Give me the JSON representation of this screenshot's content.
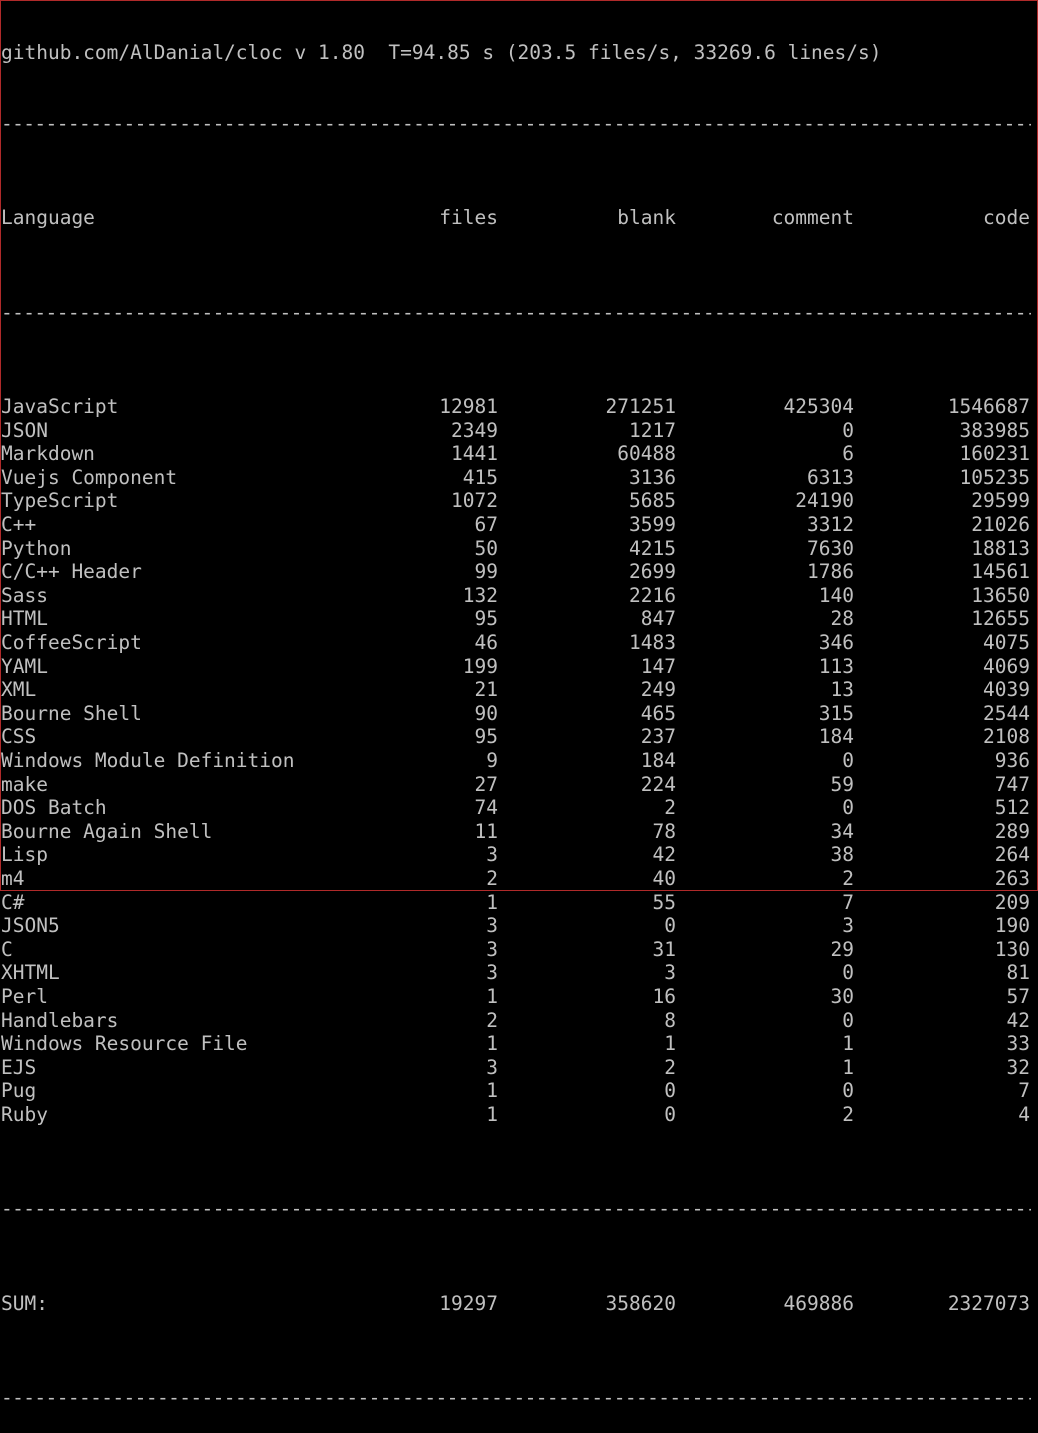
{
  "header": {
    "summary_line": "github.com/AlDanial/cloc v 1.80  T=94.85 s (203.5 files/s, 33269.6 lines/s)"
  },
  "separator": "-----------------------------------------------------------------------------------------------",
  "columns": {
    "language": "Language",
    "files": "files",
    "blank": "blank",
    "comment": "comment",
    "code": "code"
  },
  "rows": [
    {
      "language": "JavaScript",
      "files": "12981",
      "blank": "271251",
      "comment": "425304",
      "code": "1546687"
    },
    {
      "language": "JSON",
      "files": "2349",
      "blank": "1217",
      "comment": "0",
      "code": "383985"
    },
    {
      "language": "Markdown",
      "files": "1441",
      "blank": "60488",
      "comment": "6",
      "code": "160231"
    },
    {
      "language": "Vuejs Component",
      "files": "415",
      "blank": "3136",
      "comment": "6313",
      "code": "105235"
    },
    {
      "language": "TypeScript",
      "files": "1072",
      "blank": "5685",
      "comment": "24190",
      "code": "29599"
    },
    {
      "language": "C++",
      "files": "67",
      "blank": "3599",
      "comment": "3312",
      "code": "21026"
    },
    {
      "language": "Python",
      "files": "50",
      "blank": "4215",
      "comment": "7630",
      "code": "18813"
    },
    {
      "language": "C/C++ Header",
      "files": "99",
      "blank": "2699",
      "comment": "1786",
      "code": "14561"
    },
    {
      "language": "Sass",
      "files": "132",
      "blank": "2216",
      "comment": "140",
      "code": "13650"
    },
    {
      "language": "HTML",
      "files": "95",
      "blank": "847",
      "comment": "28",
      "code": "12655"
    },
    {
      "language": "CoffeeScript",
      "files": "46",
      "blank": "1483",
      "comment": "346",
      "code": "4075"
    },
    {
      "language": "YAML",
      "files": "199",
      "blank": "147",
      "comment": "113",
      "code": "4069"
    },
    {
      "language": "XML",
      "files": "21",
      "blank": "249",
      "comment": "13",
      "code": "4039"
    },
    {
      "language": "Bourne Shell",
      "files": "90",
      "blank": "465",
      "comment": "315",
      "code": "2544"
    },
    {
      "language": "CSS",
      "files": "95",
      "blank": "237",
      "comment": "184",
      "code": "2108"
    },
    {
      "language": "Windows Module Definition",
      "files": "9",
      "blank": "184",
      "comment": "0",
      "code": "936"
    },
    {
      "language": "make",
      "files": "27",
      "blank": "224",
      "comment": "59",
      "code": "747"
    },
    {
      "language": "DOS Batch",
      "files": "74",
      "blank": "2",
      "comment": "0",
      "code": "512"
    },
    {
      "language": "Bourne Again Shell",
      "files": "11",
      "blank": "78",
      "comment": "34",
      "code": "289"
    },
    {
      "language": "Lisp",
      "files": "3",
      "blank": "42",
      "comment": "38",
      "code": "264"
    },
    {
      "language": "m4",
      "files": "2",
      "blank": "40",
      "comment": "2",
      "code": "263"
    },
    {
      "language": "C#",
      "files": "1",
      "blank": "55",
      "comment": "7",
      "code": "209"
    },
    {
      "language": "JSON5",
      "files": "3",
      "blank": "0",
      "comment": "3",
      "code": "190"
    },
    {
      "language": "C",
      "files": "3",
      "blank": "31",
      "comment": "29",
      "code": "130"
    },
    {
      "language": "XHTML",
      "files": "3",
      "blank": "3",
      "comment": "0",
      "code": "81"
    },
    {
      "language": "Perl",
      "files": "1",
      "blank": "16",
      "comment": "30",
      "code": "57"
    },
    {
      "language": "Handlebars",
      "files": "2",
      "blank": "8",
      "comment": "0",
      "code": "42"
    },
    {
      "language": "Windows Resource File",
      "files": "1",
      "blank": "1",
      "comment": "1",
      "code": "33"
    },
    {
      "language": "EJS",
      "files": "3",
      "blank": "2",
      "comment": "1",
      "code": "32"
    },
    {
      "language": "Pug",
      "files": "1",
      "blank": "0",
      "comment": "0",
      "code": "7"
    },
    {
      "language": "Ruby",
      "files": "1",
      "blank": "0",
      "comment": "2",
      "code": "4"
    }
  ],
  "sum": {
    "language": "SUM:",
    "files": "19297",
    "blank": "358620",
    "comment": "469886",
    "code": "2327073"
  },
  "colors": {
    "background": "#000000",
    "text": "#c0c0c0",
    "window_border": "#b02a2a"
  }
}
